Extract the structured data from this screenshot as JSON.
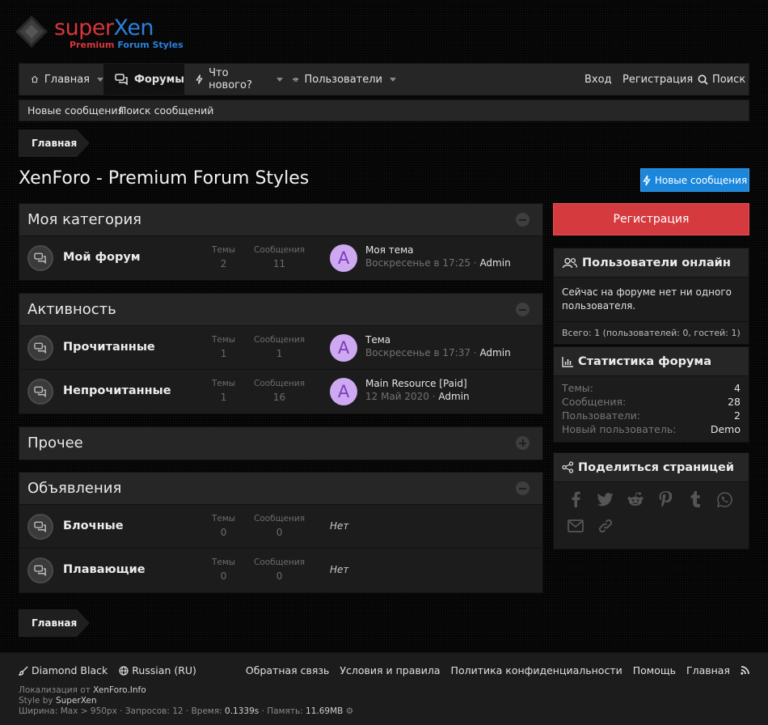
{
  "logo": {
    "word1": "super",
    "word2": "Xen",
    "tag1": "Premium",
    "tag2": "Forum Styles"
  },
  "nav": {
    "home": "Главная",
    "forums": "Форумы",
    "whats_new": "Что нового?",
    "members": "Пользователи",
    "login": "Вход",
    "register": "Регистрация",
    "search": "Поиск"
  },
  "subnav": {
    "new_posts": "Новые сообщения",
    "search_posts": "Поиск сообщений"
  },
  "breadcrumb": "Главная",
  "page_title": "XenForo - Premium Forum Styles",
  "new_posts_button": "Новые сообщения",
  "categories": [
    {
      "title": "Моя категория",
      "nodes": [
        {
          "name": "Мой форум",
          "threads_label": "Темы",
          "threads": "2",
          "posts_label": "Сообщения",
          "posts": "11",
          "avatar": "A",
          "last_title": "Моя тема",
          "last_date": "Воскресенье в 17:25",
          "last_user": "Admin"
        }
      ]
    },
    {
      "title": "Активность",
      "nodes": [
        {
          "name": "Прочитанные",
          "threads_label": "Темы",
          "threads": "1",
          "posts_label": "Сообщения",
          "posts": "1",
          "avatar": "A",
          "last_title": "Тема",
          "last_date": "Воскресенье в 17:37",
          "last_user": "Admin"
        },
        {
          "name": "Непрочитанные",
          "threads_label": "Темы",
          "threads": "1",
          "posts_label": "Сообщения",
          "posts": "16",
          "avatar": "A",
          "last_title": "Main Resource [Paid]",
          "last_date": "12 Май 2020",
          "last_user": "Admin"
        }
      ]
    },
    {
      "title": "Прочее",
      "nodes": []
    },
    {
      "title": "Объявления",
      "nodes": [
        {
          "name": "Блочные",
          "threads_label": "Темы",
          "threads": "0",
          "posts_label": "Сообщения",
          "posts": "0",
          "none": "Нет"
        },
        {
          "name": "Плавающие",
          "threads_label": "Темы",
          "threads": "0",
          "posts_label": "Сообщения",
          "posts": "0",
          "none": "Нет"
        }
      ]
    }
  ],
  "sidebar": {
    "register_button": "Регистрация",
    "online": {
      "title": "Пользователи онлайн",
      "text": "Сейчас на форуме нет ни одного пользователя.",
      "total": "Всего: 1 (пользователей: 0, гостей: 1)"
    },
    "stats": {
      "title": "Статистика форума",
      "rows": [
        {
          "k": "Темы:",
          "v": "4"
        },
        {
          "k": "Сообщения:",
          "v": "28"
        },
        {
          "k": "Пользователи:",
          "v": "2"
        },
        {
          "k": "Новый пользователь:",
          "v": "Demo"
        }
      ]
    },
    "share": {
      "title": "Поделиться страницей",
      "icons": [
        "facebook-icon",
        "twitter-icon",
        "reddit-icon",
        "pinterest-icon",
        "tumblr-icon",
        "whatsapp-icon",
        "email-icon",
        "link-icon"
      ]
    }
  },
  "footer": {
    "style": "Diamond Black",
    "language": "Russian (RU)",
    "links": [
      "Обратная связь",
      "Условия и правила",
      "Политика конфиденциальности",
      "Помощь",
      "Главная"
    ],
    "loc_prefix": "Локализация от",
    "loc_name": "XenForo.Info",
    "style_prefix": "Style by",
    "style_name": "SuperXen",
    "debug_prefix": "Ширина: Max > 950px · Запросов: 12 · Время:",
    "debug_time": "0.1339s",
    "debug_mid": "· Память:",
    "debug_mem": "11.69MB"
  },
  "colors": {
    "accent_blue": "#1a87dc",
    "accent_red": "#d53a3f",
    "avatar_bg": "#cfa8f2"
  }
}
